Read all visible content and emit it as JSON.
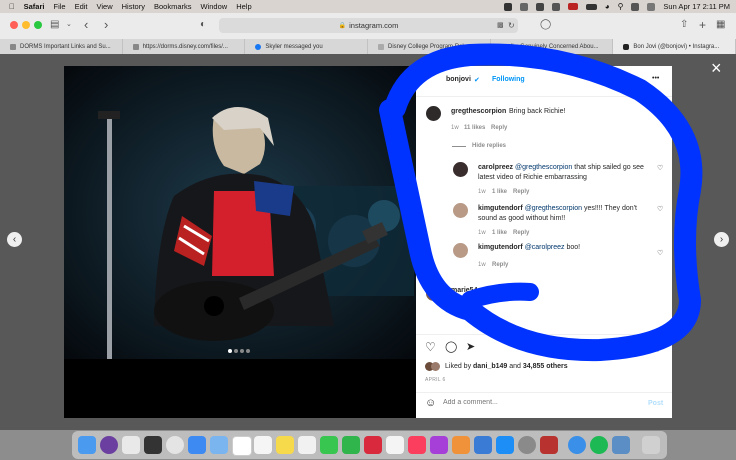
{
  "menubar": {
    "items": [
      "Safari",
      "File",
      "Edit",
      "View",
      "History",
      "Bookmarks",
      "Window",
      "Help"
    ],
    "datetime": "Sun Apr 17  2:11 PM"
  },
  "toolbar": {
    "url": "instagram.com"
  },
  "tabs": [
    {
      "label": "DORMS Important Links and Su...",
      "active": false
    },
    {
      "label": "https://dorms.disney.com/files/...",
      "active": false
    },
    {
      "label": "Skyler messaged you",
      "active": false
    },
    {
      "label": "Disney College Program Roles...",
      "active": false
    },
    {
      "label": "I'm Genuinely Concerned Abou...",
      "active": false
    },
    {
      "label": "Bon Jovi (@bonjovi) • Instagra...",
      "active": true
    }
  ],
  "post": {
    "author": "bonjovi",
    "follow_label": "Following",
    "more": "•••",
    "comments": [
      {
        "user": "gregthescorpion",
        "text": "Bring back Richie!",
        "age": "1w",
        "likes": "11 likes",
        "reply": "Reply"
      },
      {
        "user": "carolpreez",
        "mention": "@gregthescorpion",
        "text": "that ship sailed go see latest video of Richie embarrassing",
        "age": "1w",
        "likes": "1 like",
        "reply": "Reply"
      },
      {
        "user": "kimgutendorf",
        "mention": "@gregthescorpion",
        "text": "yes!!!! They don't sound as good without him!!",
        "age": "1w",
        "likes": "1 like",
        "reply": "Reply"
      },
      {
        "user": "kimgutendorf",
        "mention": "@carolpreez",
        "text": "boo!",
        "age": "1w",
        "likes": "",
        "reply": "Reply"
      },
      {
        "user": "marie54",
        "text": "Loved",
        "age": "",
        "likes": "",
        "reply": ""
      }
    ],
    "hide_replies": "Hide replies",
    "liked_by_prefix": "Liked by",
    "liked_by_user": "dani_b149",
    "liked_by_and": "and",
    "liked_by_count": "34,855 others",
    "date": "APRIL 6",
    "add_comment_placeholder": "Add a comment...",
    "post_label": "Post"
  },
  "icons": {
    "close": "×",
    "prev": "‹",
    "next": "›"
  },
  "colors": {
    "scribble": "#0033ff",
    "instagram_link": "#0095f6",
    "shirt_red": "#d4202c"
  }
}
